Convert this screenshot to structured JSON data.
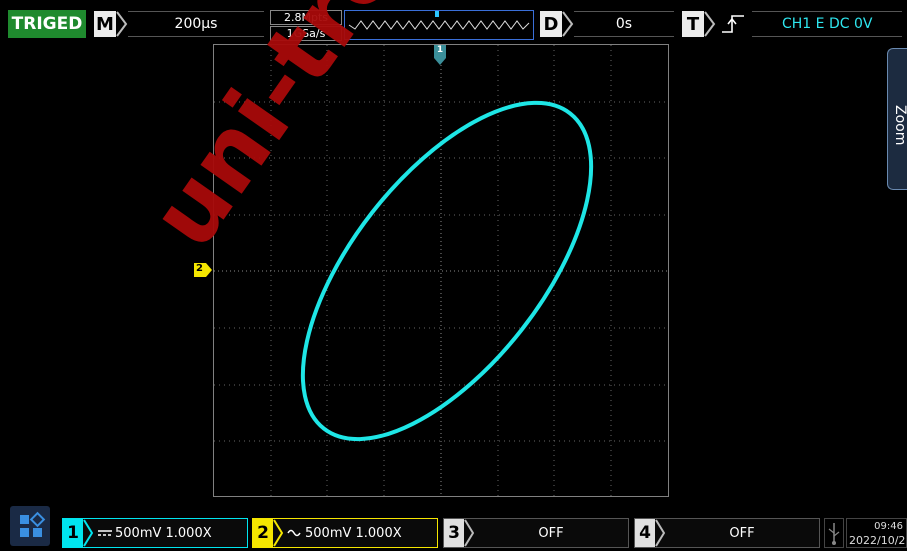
{
  "status": {
    "trigger_state": "TRIGED"
  },
  "timebase": {
    "letter": "M",
    "value": "200µs"
  },
  "acquisition": {
    "memory_depth": "2.8Mpts",
    "sample_rate": "1GSa/s"
  },
  "delay": {
    "letter": "D",
    "value": "0s"
  },
  "trigger": {
    "letter": "T",
    "summary": "CH1 E DC 0V"
  },
  "zoom_tab": {
    "label": "Zoom"
  },
  "markers": {
    "ch1_position": "1",
    "ch2_level": "2"
  },
  "watermark": "uni-trend",
  "channels": [
    {
      "number": "1",
      "coupling_icon": "dc-coupling-icon",
      "text": "500mV 1.000X",
      "color": "#00e5ef"
    },
    {
      "number": "2",
      "coupling_icon": "ac-coupling-icon",
      "text": "500mV 1.000X",
      "color": "#f5e600"
    },
    {
      "number": "3",
      "text": "OFF"
    },
    {
      "number": "4",
      "text": "OFF"
    }
  ],
  "clock": {
    "time": "09:46",
    "date": "2022/10/2"
  },
  "colors": {
    "trace": "#1ee6e6",
    "triged_bg": "#1f8a2e",
    "watermark": "#a80a0a"
  }
}
